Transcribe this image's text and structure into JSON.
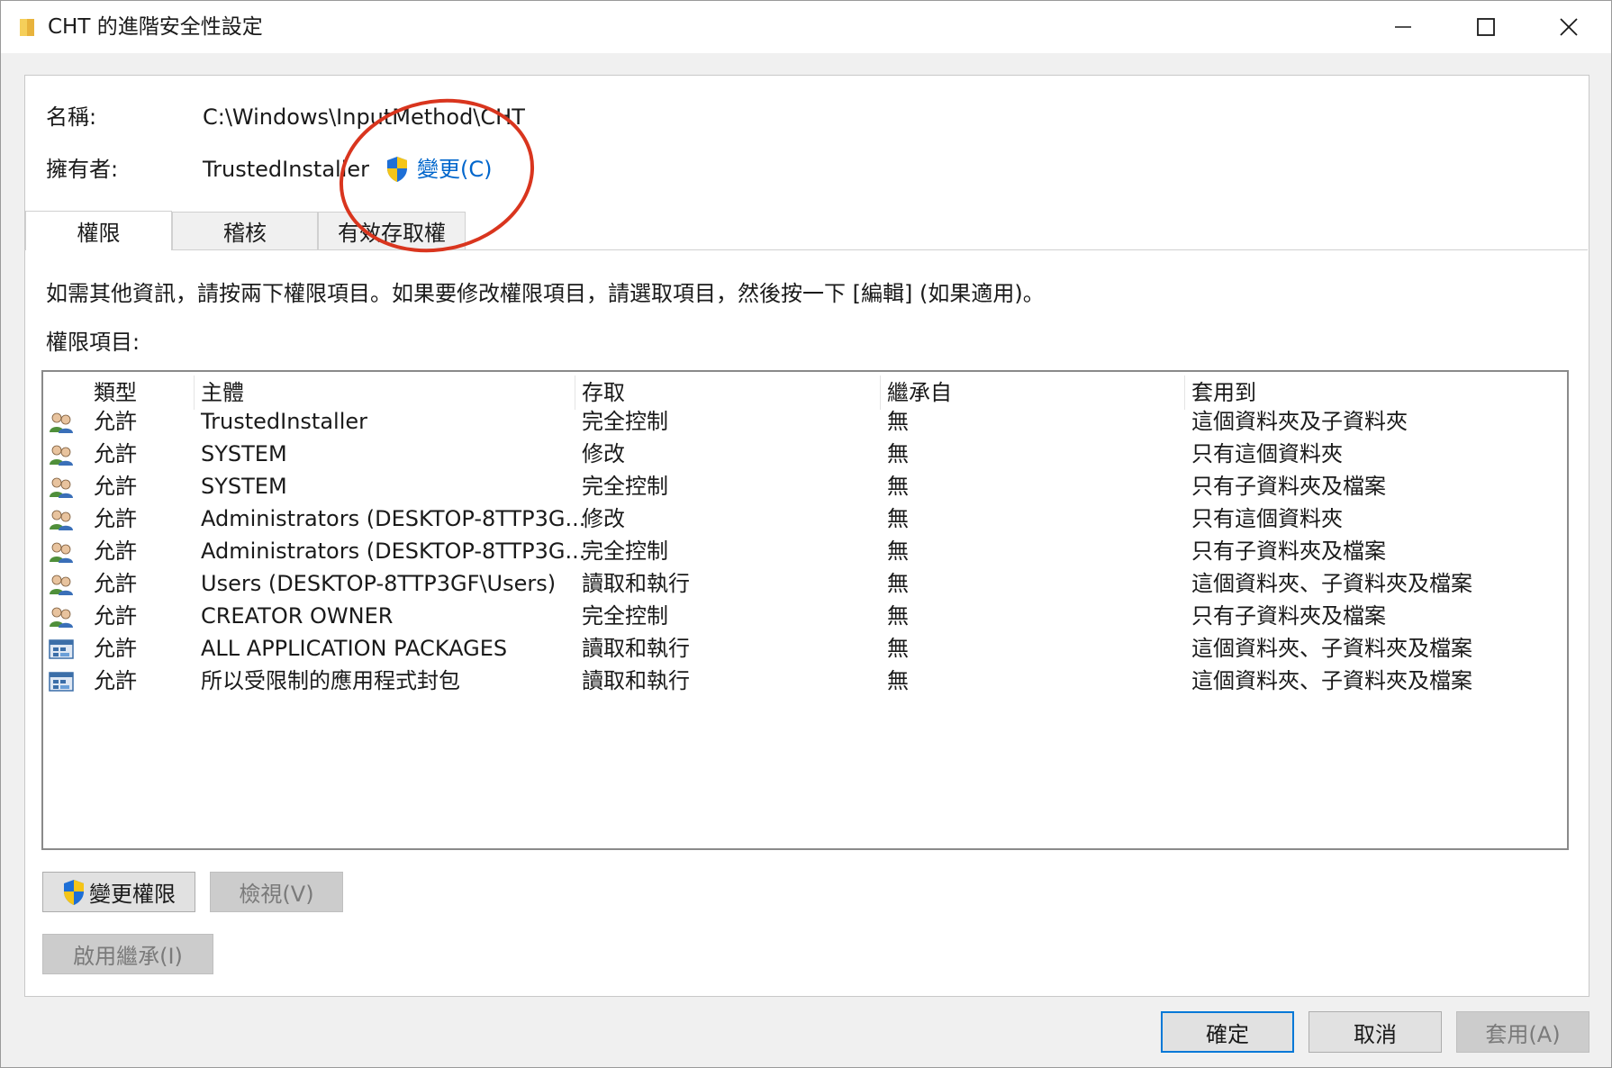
{
  "window": {
    "title": "CHT 的進階安全性設定"
  },
  "info": {
    "name_label": "名稱:",
    "name_value": "C:\\Windows\\InputMethod\\CHT",
    "owner_label": "擁有者:",
    "owner_value": "TrustedInstaller",
    "change_owner_link": "變更(C)"
  },
  "tabs": [
    {
      "label": "權限",
      "active": true
    },
    {
      "label": "稽核",
      "active": false
    },
    {
      "label": "有效存取權",
      "active": false
    }
  ],
  "instructions": "如需其他資訊，請按兩下權限項目。如果要修改權限項目，請選取項目，然後按一下 [編輯] (如果適用)。",
  "entries_label": "權限項目:",
  "table": {
    "columns": [
      "類型",
      "主體",
      "存取",
      "繼承自",
      "套用到"
    ],
    "rows": [
      {
        "icon": "user-group-icon",
        "type": "允許",
        "principal": "TrustedInstaller",
        "access": "完全控制",
        "inherited": "無",
        "applies": "這個資料夾及子資料夾"
      },
      {
        "icon": "user-group-icon",
        "type": "允許",
        "principal": "SYSTEM",
        "access": "修改",
        "inherited": "無",
        "applies": "只有這個資料夾"
      },
      {
        "icon": "user-group-icon",
        "type": "允許",
        "principal": "SYSTEM",
        "access": "完全控制",
        "inherited": "無",
        "applies": "只有子資料夾及檔案"
      },
      {
        "icon": "user-group-icon",
        "type": "允許",
        "principal": "Administrators (DESKTOP-8TTP3G...",
        "access": "修改",
        "inherited": "無",
        "applies": "只有這個資料夾"
      },
      {
        "icon": "user-group-icon",
        "type": "允許",
        "principal": "Administrators (DESKTOP-8TTP3G...",
        "access": "完全控制",
        "inherited": "無",
        "applies": "只有子資料夾及檔案"
      },
      {
        "icon": "user-group-icon",
        "type": "允許",
        "principal": "Users (DESKTOP-8TTP3GF\\Users)",
        "access": "讀取和執行",
        "inherited": "無",
        "applies": "這個資料夾、子資料夾及檔案"
      },
      {
        "icon": "user-group-icon",
        "type": "允許",
        "principal": "CREATOR OWNER",
        "access": "完全控制",
        "inherited": "無",
        "applies": "只有子資料夾及檔案"
      },
      {
        "icon": "app-package-icon",
        "type": "允許",
        "principal": "ALL APPLICATION PACKAGES",
        "access": "讀取和執行",
        "inherited": "無",
        "applies": "這個資料夾、子資料夾及檔案"
      },
      {
        "icon": "app-package-icon",
        "type": "允許",
        "principal": "所以受限制的應用程式封包",
        "access": "讀取和執行",
        "inherited": "無",
        "applies": "這個資料夾、子資料夾及檔案"
      }
    ]
  },
  "buttons": {
    "change_permissions": "變更權限",
    "view": "檢視(V)",
    "enable_inheritance": "啟用繼承(I)",
    "ok": "確定",
    "cancel": "取消",
    "apply": "套用(A)"
  },
  "colors": {
    "link": "#0066cc",
    "annotation": "#d9351e",
    "default_button_border": "#0078d7"
  }
}
